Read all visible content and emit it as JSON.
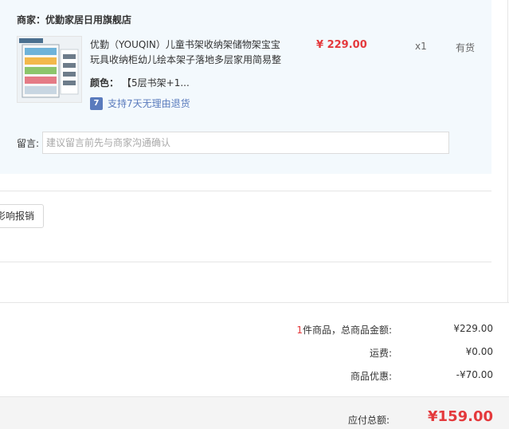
{
  "merchant": {
    "label": "商家：",
    "name": "优勤家居日用旗舰店"
  },
  "product": {
    "name": "优勤（YOUQIN）儿童书架收纳架储物架宝宝玩具收纳柜幼儿绘本架子落地多层家用简易整",
    "price": "¥ 229.00",
    "qty": "x1",
    "stock": "有货",
    "color_label": "颜色：",
    "color_value": "【5层书架+1...",
    "return_icon": "7",
    "return_text": "支持7天无理由退货"
  },
  "note": {
    "label": "留言:",
    "placeholder": "建议留言前先与商家沟通确认"
  },
  "invoice": {
    "button_label": "影响报销"
  },
  "summary": {
    "count": "1",
    "count_label": "件商品，总商品金额:",
    "goods_total": "¥229.00",
    "shipping_label": "运费:",
    "shipping": "¥0.00",
    "discount_label": "商品优惠:",
    "discount": "-¥70.00",
    "payable_label": "应付总额:",
    "payable": "¥159.00"
  },
  "colors": {
    "price_red": "#e4393c",
    "link_blue": "#5a7bbd",
    "panel_bg": "#f3f9fd"
  },
  "icons": {
    "return_badge": "return-7-days-icon"
  }
}
